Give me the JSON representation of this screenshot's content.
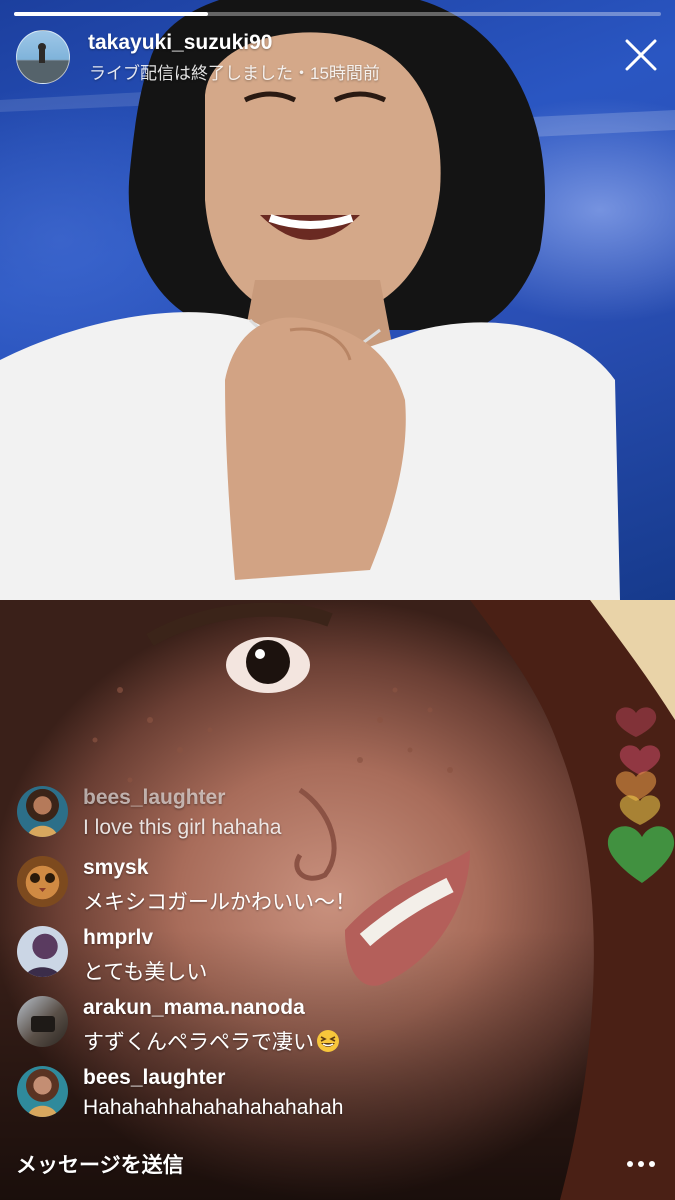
{
  "live": {
    "progress_fraction": 0.3,
    "host": {
      "username": "takayuki_suzuki90",
      "status": "ライブ配信は終了しました・15時間前"
    }
  },
  "comments": [
    {
      "username": "bees_laughter",
      "text": "I love this girl hahaha",
      "avatar_icon": "profile-photo",
      "faded": true
    },
    {
      "username": "smysk",
      "text": "メキシコガールかわいい〜！",
      "avatar_icon": "profile-photo"
    },
    {
      "username": "hmprlv",
      "text": "とても美しい",
      "avatar_icon": "profile-photo"
    },
    {
      "username": "arakun_mama.nanoda",
      "text": "すずくんペラペラで凄い",
      "emoji": "grinning-squinting-face",
      "avatar_icon": "profile-photo"
    },
    {
      "username": "bees_laughter",
      "text": "Hahahahhahahahahahahah",
      "avatar_icon": "profile-photo"
    }
  ],
  "footer": {
    "message_placeholder": "メッセージを送信",
    "more_icon": "more-dots-icon"
  },
  "colors": {
    "heart_pink": "#e9557a",
    "heart_orange": "#f0a34a",
    "heart_yellow": "#f5d34f",
    "heart_green": "#3fae4b"
  }
}
